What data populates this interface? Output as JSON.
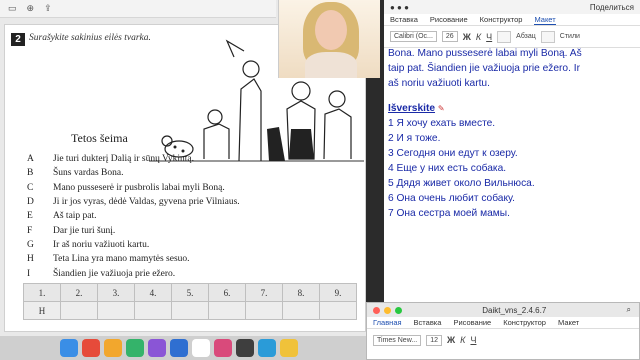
{
  "exercise": {
    "number": "2",
    "instruction": "Surašykite sakinius eilės tvarka.",
    "story_title": "Tetos šeima",
    "sentences": [
      {
        "letter": "A",
        "text": "Jie turi dukterį Dalią ir sūnų Vykintą."
      },
      {
        "letter": "B",
        "text": "Šuns vardas Bona."
      },
      {
        "letter": "C",
        "text": "Mano pusseserė ir pusbrolis labai myli Boną."
      },
      {
        "letter": "D",
        "text": "Ji ir jos vyras, dėdė Valdas, gyvena prie Vilniaus."
      },
      {
        "letter": "E",
        "text": "Aš taip pat."
      },
      {
        "letter": "F",
        "text": "Dar jie turi šunį."
      },
      {
        "letter": "G",
        "text": "Ir aš noriu važiuoti kartu."
      },
      {
        "letter": "H",
        "text": "Teta Lina yra mano mamytės sesuo."
      },
      {
        "letter": "I",
        "text": "Šiandien jie važiuoja prie ežero."
      }
    ],
    "answer_headers": [
      "1.",
      "2.",
      "3.",
      "4.",
      "5.",
      "6.",
      "7.",
      "8.",
      "9."
    ],
    "answer_row": [
      "H",
      "",
      "",
      "",
      "",
      "",
      "",
      "",
      ""
    ]
  },
  "word_main": {
    "share_label": "Поделиться",
    "tabs": [
      "Вставка",
      "Рисование",
      "Конструктор",
      "Макет"
    ],
    "font_name": "Calibri (Oc...",
    "font_size": "26",
    "paragraph_label": "Абзац",
    "styles_label": "Стили",
    "text_lines": [
      "Bona. Mano pusseserė labai myli Boną. Aš",
      "taip pat. Šiandien jie važiuoja prie ežero. Ir",
      "aš noriu važiuoti kartu."
    ],
    "heading": "Išverskite",
    "translation_items": [
      "1 Я хочу ехать вместе.",
      "2 И я тоже.",
      "3 Сегодня они едут к озеру.",
      "4 Еще у них есть собака.",
      "5 Дядя живет около Вильнюса.",
      "6 Она очень любит собаку.",
      "7 Она сестра моей мамы."
    ]
  },
  "word_second": {
    "title": "Daikt_vns_2.4.6.7",
    "tabs": [
      "Главная",
      "Вставка",
      "Рисование",
      "Конструктор",
      "Макет"
    ],
    "font_name": "Times New...",
    "font_size": "12"
  }
}
